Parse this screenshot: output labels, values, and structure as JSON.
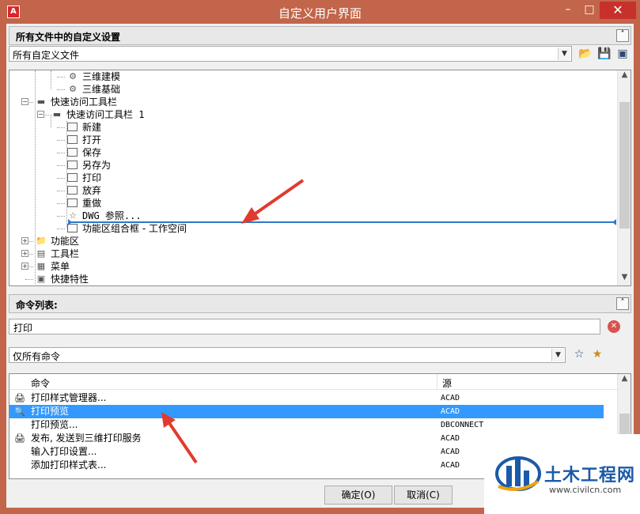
{
  "window": {
    "title": "自定义用户界面",
    "app_icon": "autocad-icon",
    "minimize_icon": "minimize-icon",
    "maximize_icon": "maximize-icon",
    "close_icon": "close-icon",
    "min_glyph": "–",
    "max_glyph": "□",
    "close_glyph": "✕",
    "accent": "#c2654a",
    "close_color": "#c7312b"
  },
  "customizations": {
    "header": "所有文件中的自定义设置",
    "collapse_glyph": "˄",
    "file_filter": "所有自定义文件",
    "dropdown_glyph": "▼",
    "tools": [
      {
        "icon": "open-file-icon",
        "glyph": "📂"
      },
      {
        "icon": "save-icon",
        "glyph": "💾"
      },
      {
        "icon": "preview-icon",
        "glyph": "▣"
      }
    ]
  },
  "tree": {
    "items": [
      {
        "label": "三维建模",
        "icon": "gear-icon",
        "glyph": "⚙",
        "indent": 3,
        "expander": ""
      },
      {
        "label": "三维基础",
        "icon": "gear-icon",
        "glyph": "⚙",
        "indent": 3,
        "expander": ""
      },
      {
        "label": "快速访问工具栏",
        "icon": "toolbar-icon",
        "glyph": "▬",
        "indent": 1,
        "expander": "−"
      },
      {
        "label": "快速访问工具栏 1",
        "icon": "toolbar-icon",
        "glyph": "▬",
        "indent": 2,
        "expander": "−"
      },
      {
        "label": "新建",
        "icon": "command-icon",
        "glyph": "",
        "indent": 3,
        "expander": ""
      },
      {
        "label": "打开",
        "icon": "command-icon",
        "glyph": "",
        "indent": 3,
        "expander": ""
      },
      {
        "label": "保存",
        "icon": "command-icon",
        "glyph": "",
        "indent": 3,
        "expander": ""
      },
      {
        "label": "另存为",
        "icon": "command-icon",
        "glyph": "",
        "indent": 3,
        "expander": ""
      },
      {
        "label": "打印",
        "icon": "command-icon",
        "glyph": "",
        "indent": 3,
        "expander": ""
      },
      {
        "label": "放弃",
        "icon": "command-icon",
        "glyph": "",
        "indent": 3,
        "expander": ""
      },
      {
        "label": "重做",
        "icon": "command-icon",
        "glyph": "",
        "indent": 3,
        "expander": ""
      },
      {
        "label": "DWG 参照...",
        "icon": "star-icon",
        "glyph": "☆",
        "indent": 3,
        "expander": ""
      },
      {
        "label": "功能区组合框 - 工作空间",
        "icon": "command-icon",
        "glyph": "",
        "indent": 3,
        "expander": ""
      },
      {
        "label": "功能区",
        "icon": "folder-icon",
        "glyph": "📁",
        "indent": 1,
        "expander": "+"
      },
      {
        "label": "工具栏",
        "icon": "toolbar-icon",
        "glyph": "▤",
        "indent": 1,
        "expander": "+"
      },
      {
        "label": "菜单",
        "icon": "menu-icon",
        "glyph": "▦",
        "indent": 1,
        "expander": "+"
      },
      {
        "label": "快捷特性",
        "icon": "properties-icon",
        "glyph": "▣",
        "indent": 1,
        "expander": ""
      }
    ],
    "drop_indicator_color": "#2e78c7"
  },
  "commands": {
    "header": "命令列表:",
    "collapse_glyph": "˄",
    "search_value": "打印",
    "clear_icon": "clear-search-icon",
    "clear_glyph": "✕",
    "filter": "仅所有命令",
    "filter_tools": [
      {
        "icon": "find-command-icon",
        "glyph": "☆"
      },
      {
        "icon": "new-command-icon",
        "glyph": "★"
      }
    ],
    "columns": {
      "command": "命令",
      "source": "源"
    },
    "rows": [
      {
        "name": "打印样式管理器...",
        "source": "ACAD",
        "icon": "printer-icon",
        "glyph": "🖨",
        "selected": false
      },
      {
        "name": "打印预览",
        "source": "ACAD",
        "icon": "print-preview-icon",
        "glyph": "🔍",
        "selected": true
      },
      {
        "name": "打印预览...",
        "source": "DBCONNECT",
        "icon": "",
        "glyph": "",
        "selected": false
      },
      {
        "name": "发布, 发送到三维打印服务",
        "source": "ACAD",
        "icon": "3d-print-icon",
        "glyph": "🖨",
        "selected": false
      },
      {
        "name": "输入打印设置...",
        "source": "ACAD",
        "icon": "",
        "glyph": "",
        "selected": false
      },
      {
        "name": "添加打印样式表...",
        "source": "ACAD",
        "icon": "",
        "glyph": "",
        "selected": false
      }
    ]
  },
  "footer": {
    "ok": "确定(O)",
    "cancel": "取消(C)"
  },
  "watermark": {
    "brand": "土木工程网",
    "url": "www.civilcn.com",
    "logo_color": "#1a5aa8"
  }
}
